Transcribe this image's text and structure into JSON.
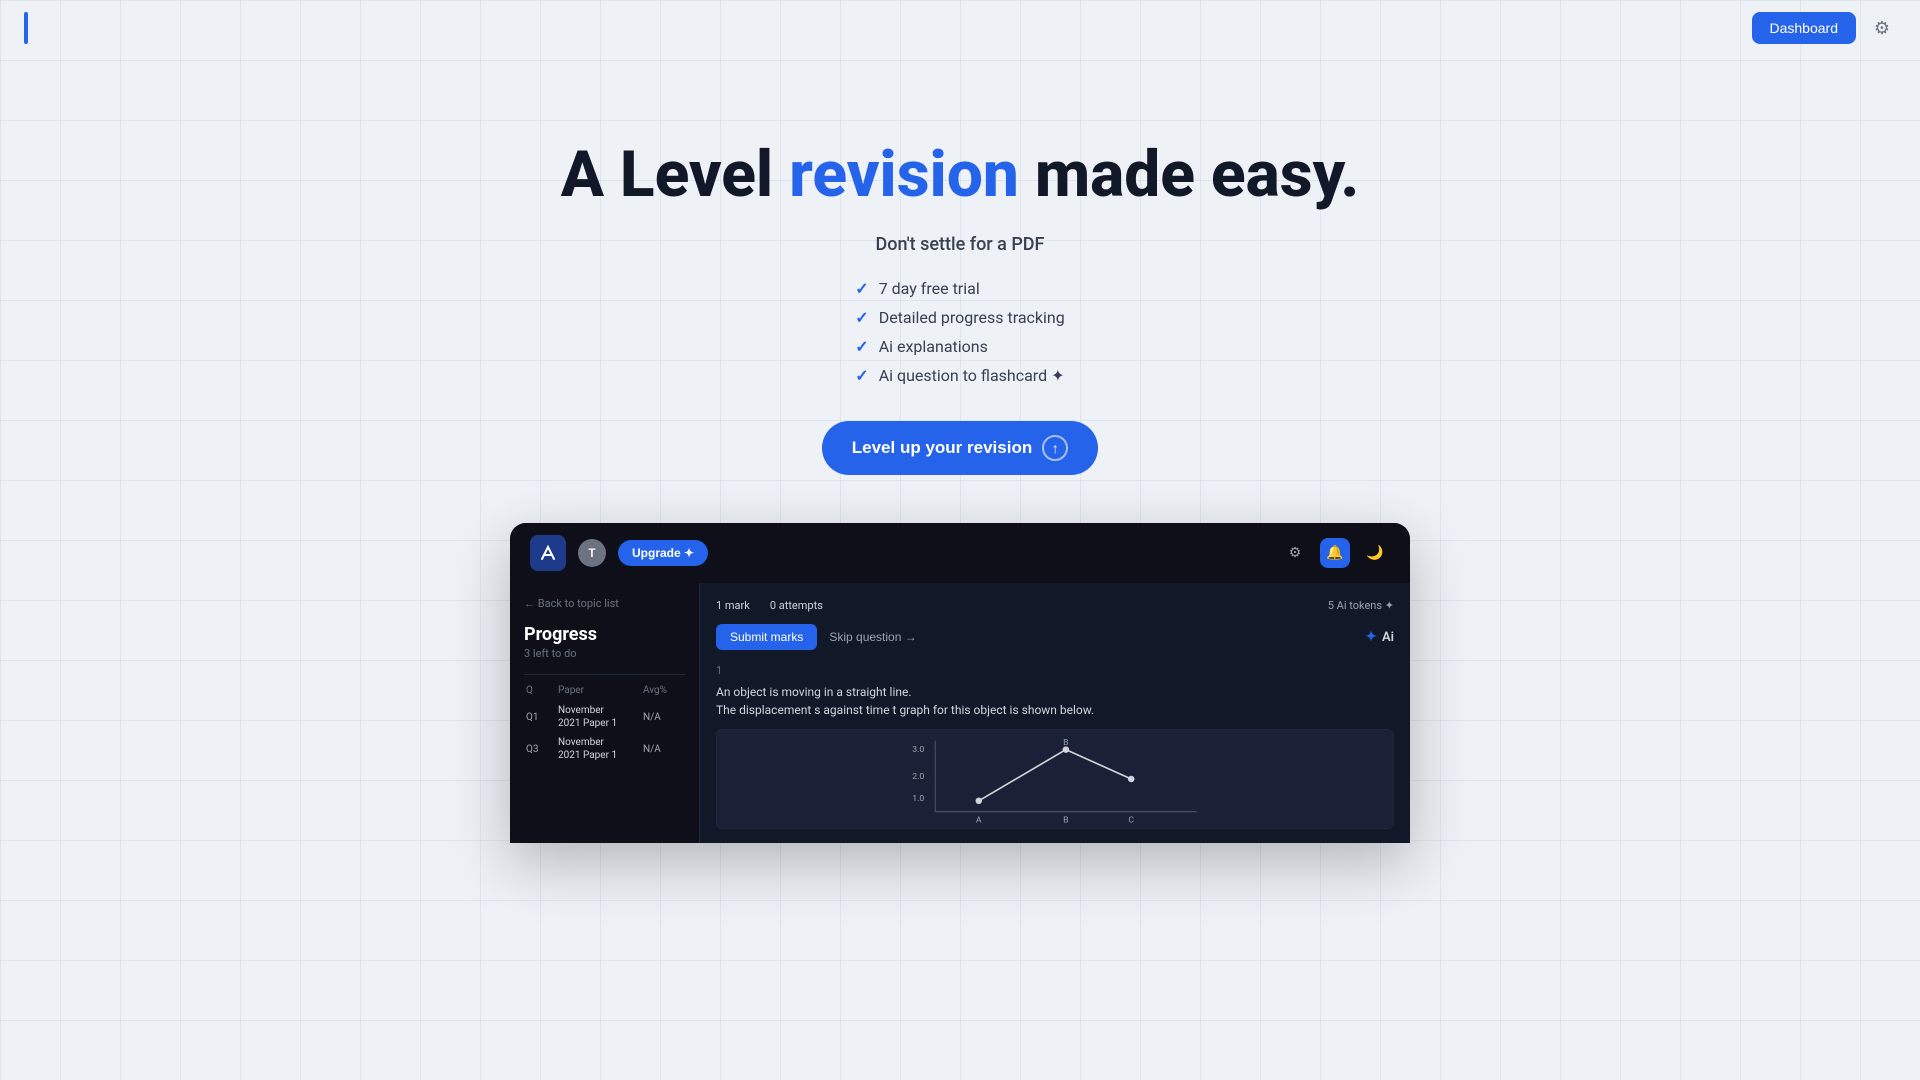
{
  "page": {
    "title": "A Level revision made easy.",
    "background_color": "#eef2f7"
  },
  "navbar": {
    "logo_bar_color": "#2563eb",
    "dashboard_button": "Dashboard",
    "settings_icon": "⚙"
  },
  "hero": {
    "heading_part1": "A Level ",
    "heading_highlight": "revision",
    "heading_part2": " made easy.",
    "subheading": "Don't settle for a PDF",
    "features": [
      {
        "text": "7 day free trial"
      },
      {
        "text": "Detailed progress tracking"
      },
      {
        "text": "Ai explanations"
      },
      {
        "text": "Ai question to flashcard ✦"
      }
    ],
    "cta_button": "Level up your ",
    "cta_button_highlight": "revision",
    "cta_arrow": "↑"
  },
  "mockup": {
    "logo_text": "Ai",
    "avatar_letter": "T",
    "upgrade_button": "Upgrade ✦",
    "icons": {
      "settings": "⚙",
      "bell": "🔔",
      "moon": "🌙"
    },
    "sidebar": {
      "back_link": "← Back to topic list",
      "progress_title": "Progress",
      "progress_subtitle": "3 left to do",
      "table_headers": [
        "Q",
        "Paper",
        "Avg%"
      ],
      "rows": [
        {
          "q": "Q1",
          "paper": "November 2021 Paper 1",
          "avg": "N/A"
        },
        {
          "q": "Q3",
          "paper": "November 2021 Paper 1",
          "avg": "N/A"
        }
      ]
    },
    "question_area": {
      "mark": "1 mark",
      "attempts": "0 attempts",
      "ai_tokens": "5 Ai tokens ✦",
      "submit_button": "Submit marks",
      "skip_button": "Skip question →",
      "ai_label": "Ai",
      "question_number": "1",
      "question_line1": "An object is moving in a straight line.",
      "question_line2": "The displacement s against time t graph for this object is shown below.",
      "chart": {
        "y_max": 3.0,
        "y_labels": [
          "3.0",
          "2.0"
        ],
        "x_labels": [
          "A",
          "B",
          "C"
        ],
        "label_b": "B"
      }
    }
  }
}
